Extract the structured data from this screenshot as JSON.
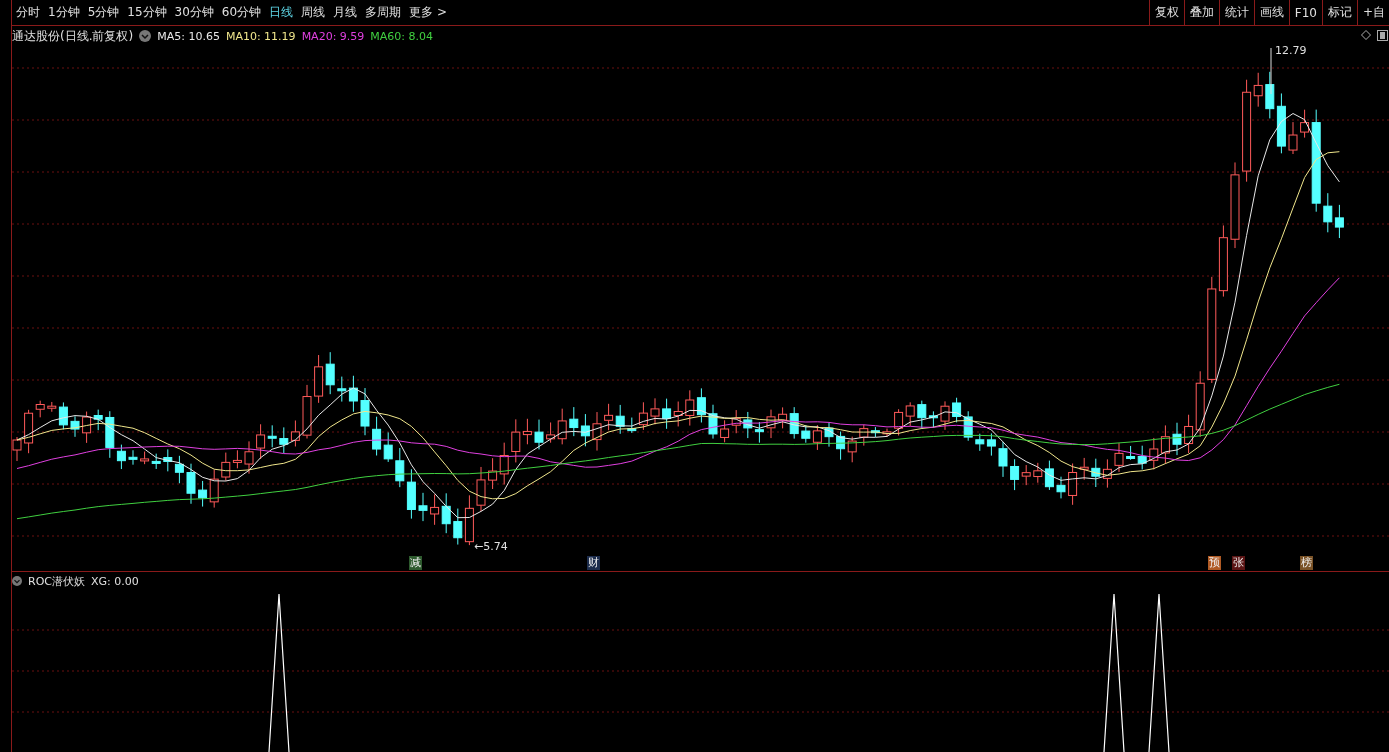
{
  "toolbar": {
    "periods": [
      {
        "label": "分时",
        "selected": false
      },
      {
        "label": "1分钟",
        "selected": false
      },
      {
        "label": "5分钟",
        "selected": false
      },
      {
        "label": "15分钟",
        "selected": false
      },
      {
        "label": "30分钟",
        "selected": false
      },
      {
        "label": "60分钟",
        "selected": false
      },
      {
        "label": "日线",
        "selected": true
      },
      {
        "label": "周线",
        "selected": false
      },
      {
        "label": "月线",
        "selected": false
      },
      {
        "label": "多周期",
        "selected": false
      },
      {
        "label": "更多 >",
        "selected": false
      }
    ],
    "tools": [
      "复权",
      "叠加",
      "统计",
      "画线",
      "F10",
      "标记",
      "+自"
    ]
  },
  "legend": {
    "title": "通达股份(日线.前复权)",
    "ma": [
      {
        "label": "MA5: 10.65",
        "color": "#e8e8e8"
      },
      {
        "label": "MA10: 11.19",
        "color": "#f0e68c"
      },
      {
        "label": "MA20: 9.59",
        "color": "#e040e0"
      },
      {
        "label": "MA60: 8.04",
        "color": "#40d040"
      }
    ]
  },
  "chart": {
    "high_label": "12.79",
    "low_label": "←5.74",
    "markers": [
      {
        "text": "减",
        "color": "#2e5a2e"
      },
      {
        "text": "财",
        "color": "#1c2c4c"
      },
      {
        "text": "预",
        "color": "#b05a24"
      },
      {
        "text": "张",
        "color": "#5a1414"
      },
      {
        "text": "榜",
        "color": "#7a5226"
      }
    ]
  },
  "indicator": {
    "title": "ROC潜伏妖",
    "reading": "XG: 0.00"
  }
}
